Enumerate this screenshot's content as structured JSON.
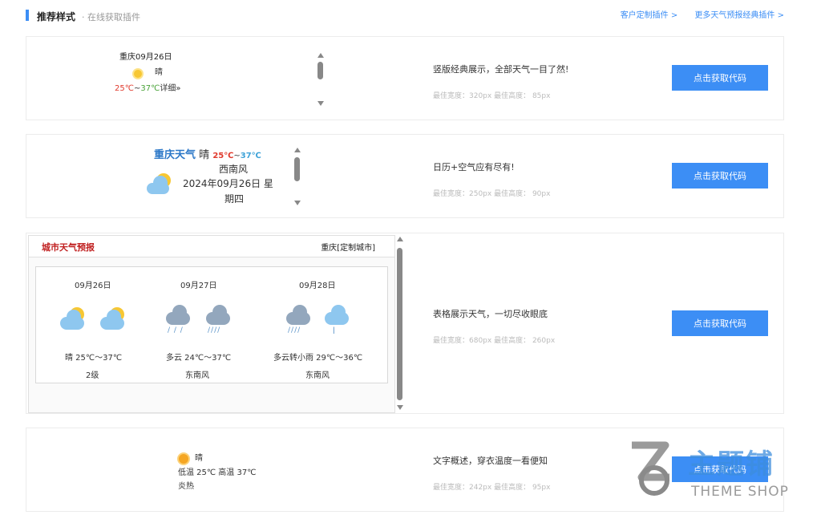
{
  "header": {
    "title": "推荐样式",
    "subtitle": "· 在线获取插件",
    "link1": "客户定制插件 >",
    "link2": "更多天气预报经典插件 >"
  },
  "button_label": "点击获取代码",
  "cards": [
    {
      "title": "竖版经典展示，全部天气一目了然!",
      "meta": "最佳宽度：320px 最佳高度： 85px",
      "widget": {
        "line1": "重庆09月26日",
        "weather": "晴",
        "low": "25℃",
        "sep": "~",
        "high": "37℃",
        "detail": "详细»"
      }
    },
    {
      "title": "日历+空气应有尽有!",
      "meta": "最佳宽度：250px 最佳高度： 90px",
      "widget": {
        "city": "重庆天气",
        "weather": "晴",
        "low": "25℃",
        "sep": "~",
        "high": "37℃",
        "wind": "西南风",
        "date": "2024年09月26日 星",
        "weekday": "期四"
      }
    },
    {
      "title": "表格展示天气，一切尽收眼底",
      "meta": "最佳宽度：680px 最佳高度： 260px",
      "widget": {
        "header_title": "城市天气预报",
        "header_city": "重庆[定制城市]",
        "days": [
          {
            "date": "09月26日",
            "temp": "晴 25℃～37℃",
            "wind": "2级"
          },
          {
            "date": "09月27日",
            "temp": "多云 24℃～37℃",
            "wind": "东南风"
          },
          {
            "date": "09月28日",
            "temp": "多云转小雨 29℃～36℃",
            "wind": "东南风"
          }
        ]
      }
    },
    {
      "title": "文字概述，穿衣温度一看便知",
      "meta": "最佳宽度：242px 最佳高度： 95px",
      "widget": {
        "weather": "晴",
        "line2": "低温 25℃ 高温 37℃",
        "line3": "炎热"
      }
    }
  ],
  "watermark": {
    "text1": "主题铺",
    "text2": "THEME SHOP"
  },
  "colors": {
    "accent": "#3c8ef5",
    "low_temp": "#e03a2d",
    "high_temp": "#4aa339"
  }
}
